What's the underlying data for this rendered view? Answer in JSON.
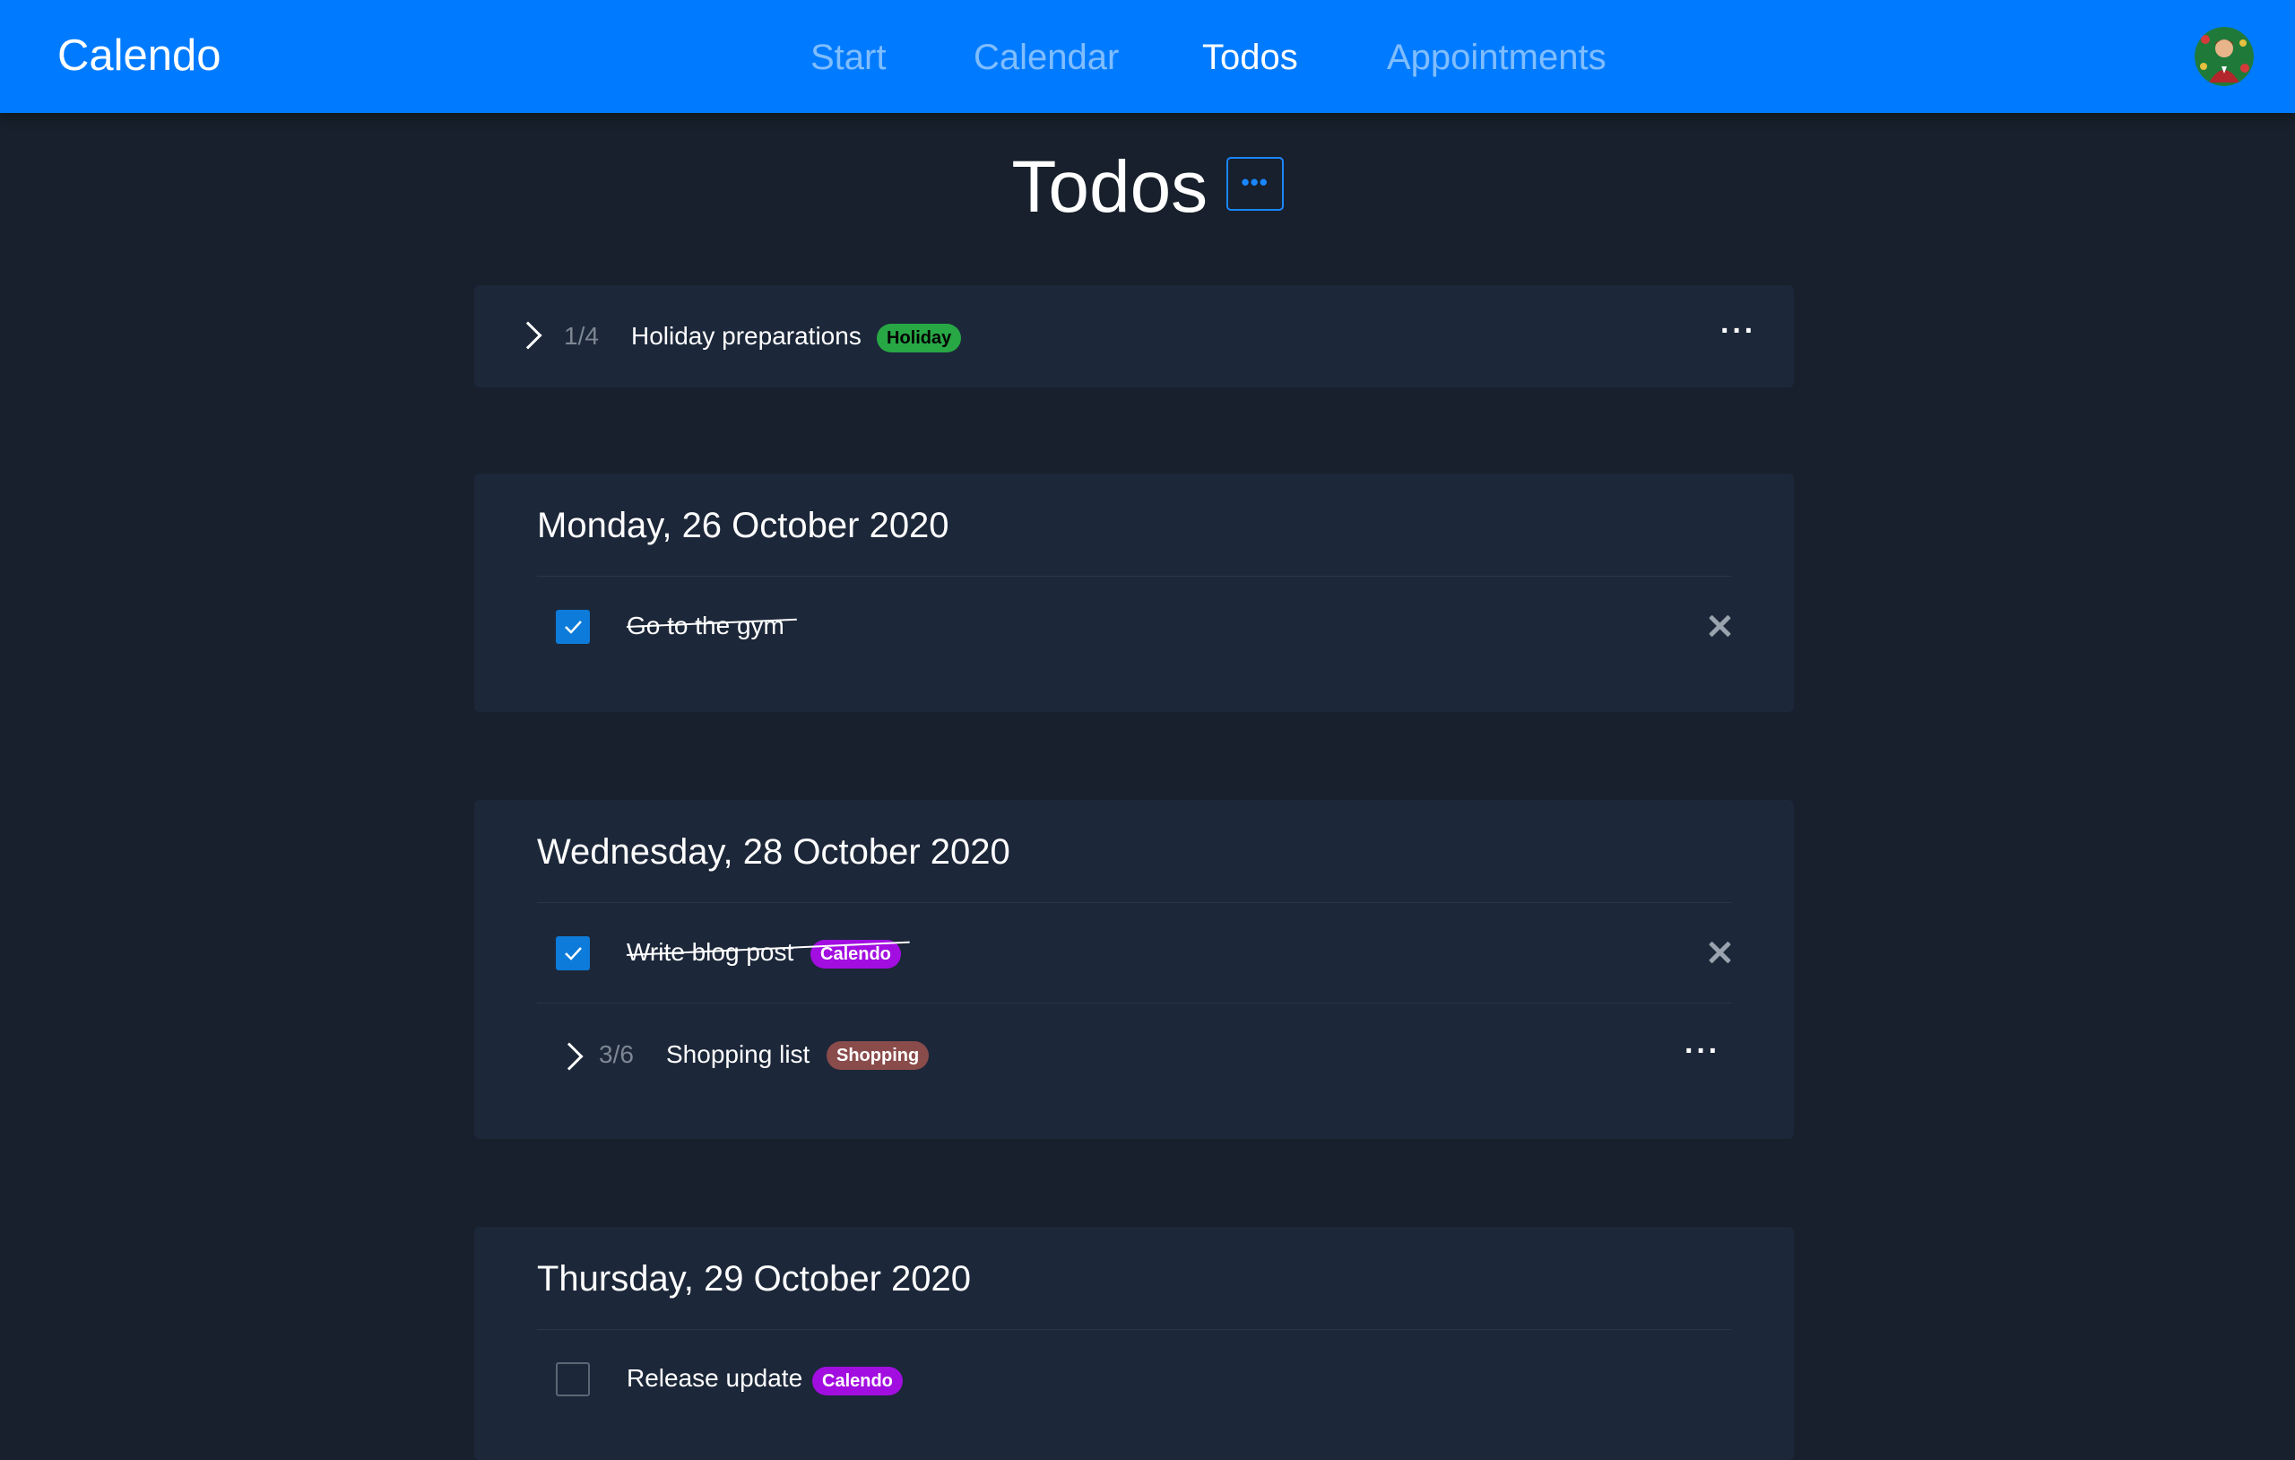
{
  "app": {
    "brand": "Calendo",
    "nav": [
      {
        "label": "Start",
        "active": false
      },
      {
        "label": "Calendar",
        "active": false
      },
      {
        "label": "Todos",
        "active": true
      },
      {
        "label": "Appointments",
        "active": false
      }
    ],
    "avatar_icon": "user-avatar"
  },
  "page": {
    "title": "Todos",
    "menu_icon": "ellipsis-icon"
  },
  "undated": {
    "group": {
      "count": "1/4",
      "title": "Holiday preparations",
      "tag": {
        "label": "Holiday",
        "color": "#28a745",
        "text_color": "#000000"
      }
    }
  },
  "days": [
    {
      "heading": "Monday, 26 October 2020",
      "todos": [
        {
          "label": "Go to the gym",
          "done": true
        }
      ]
    },
    {
      "heading": "Wednesday, 28 October 2020",
      "todos": [
        {
          "label": "Write blog post",
          "done": true,
          "tag": {
            "label": "Calendo",
            "color": "#a20ee0",
            "text_color": "#ffffff"
          }
        }
      ],
      "group": {
        "count": "3/6",
        "title": "Shopping list",
        "tag": {
          "label": "Shopping",
          "color": "#8a4b4b",
          "text_color": "#ffffff"
        }
      }
    },
    {
      "heading": "Thursday, 29 October 2020",
      "todos": [
        {
          "label": "Release update",
          "done": false,
          "tag": {
            "label": "Calendo",
            "color": "#a20ee0",
            "text_color": "#ffffff"
          }
        }
      ]
    }
  ],
  "colors": {
    "navbar": "#007bff",
    "background": "#17202c",
    "card": "#1c2739",
    "checkbox_checked": "#0d7bd9"
  }
}
